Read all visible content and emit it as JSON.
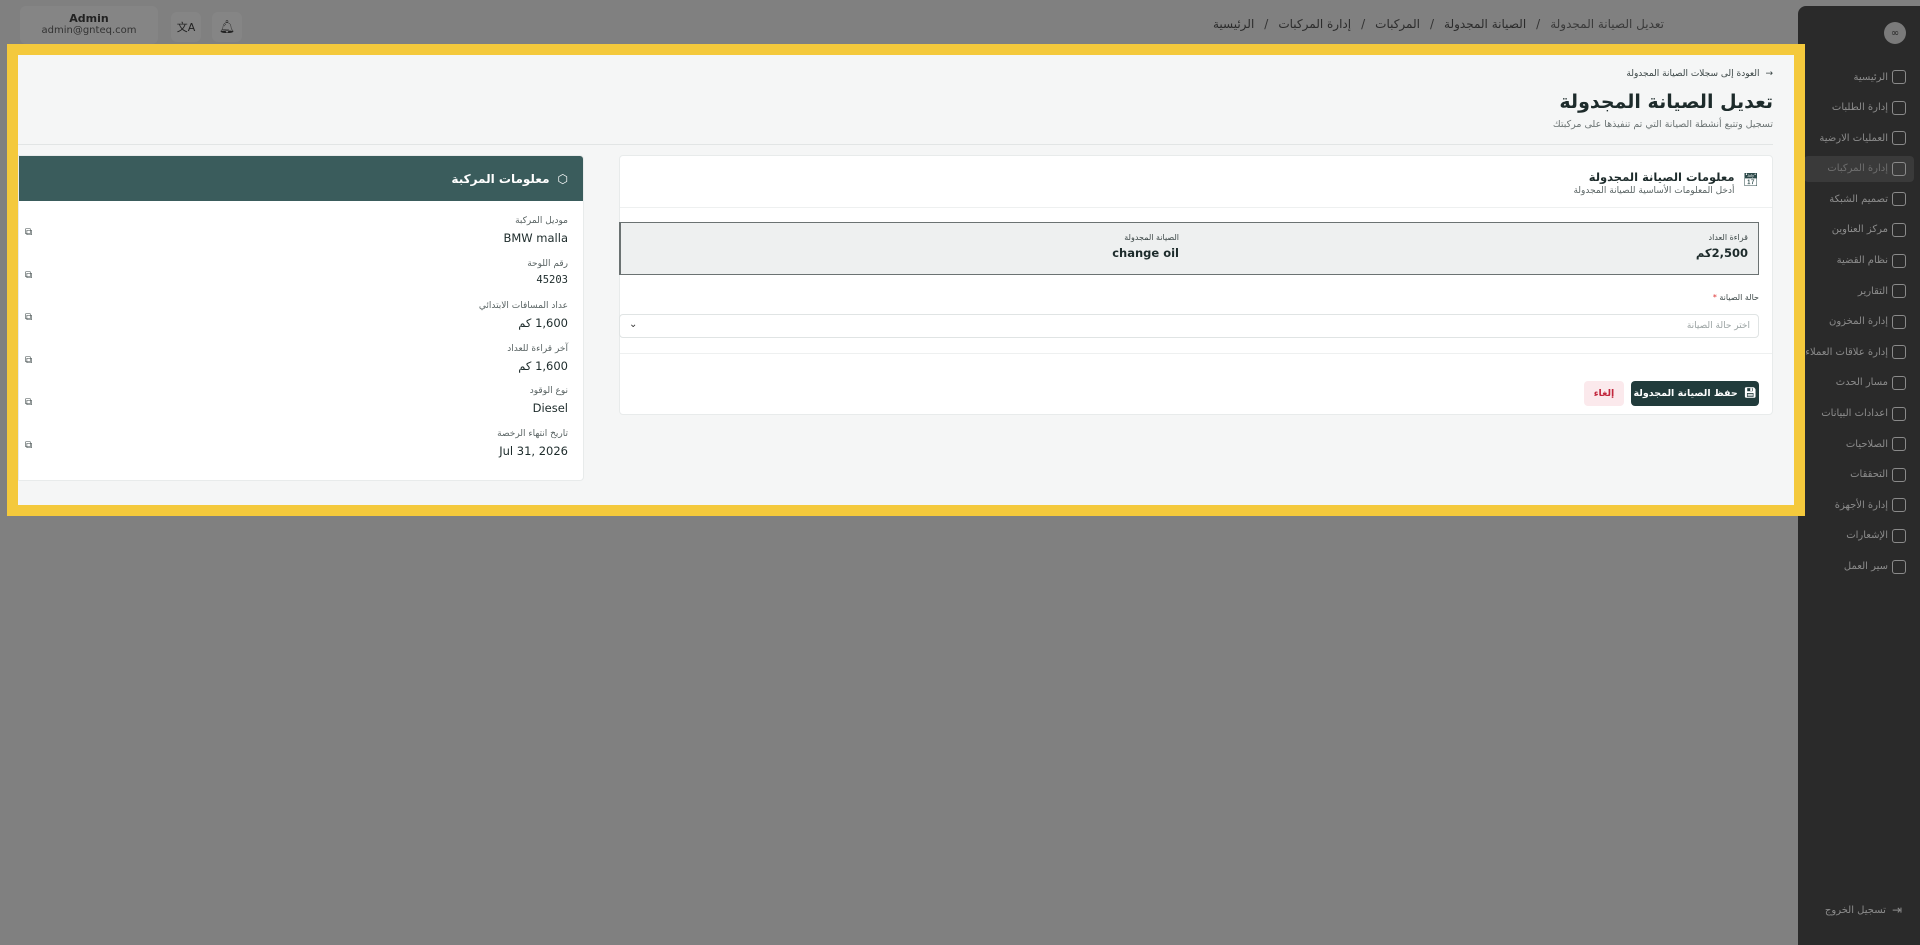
{
  "header": {
    "breadcrumbs": [
      "الرئيسية",
      "إدارة المركبات",
      "المركبات",
      "الصيانة المجدولة",
      "تعديل الصيانة المجدولة"
    ],
    "user_name": "Admin",
    "user_email": "admin@gnteq.com"
  },
  "sidebar": {
    "items": [
      {
        "label": "الرئيسية",
        "icon": "dashboard-icon"
      },
      {
        "label": "إدارة الطلبات",
        "icon": "orders-icon"
      },
      {
        "label": "العمليات الارضية",
        "icon": "ground-ops-icon"
      },
      {
        "label": "إدارة المركبات",
        "icon": "truck-icon",
        "active": true
      },
      {
        "label": "تصميم الشبكة",
        "icon": "network-icon"
      },
      {
        "label": "مركز العناوين",
        "icon": "address-icon"
      },
      {
        "label": "نظام القضية",
        "icon": "case-icon"
      },
      {
        "label": "التقارير",
        "icon": "reports-icon"
      },
      {
        "label": "إدارة المخزون",
        "icon": "inventory-icon"
      },
      {
        "label": "إدارة علاقات العملاء",
        "icon": "crm-icon"
      },
      {
        "label": "مسار الحدث",
        "icon": "event-path-icon"
      },
      {
        "label": "اعدادات البيانات",
        "icon": "database-icon"
      },
      {
        "label": "الصلاحيات",
        "icon": "users-icon"
      },
      {
        "label": "التحققات",
        "icon": "tools-icon"
      },
      {
        "label": "إدارة الأجهزة",
        "icon": "devices-icon"
      },
      {
        "label": "الإشعارات",
        "icon": "bell-icon"
      },
      {
        "label": "سير العمل",
        "icon": "workflow-icon"
      }
    ],
    "logout": "تسجيل الخروج"
  },
  "page": {
    "back_link": "العودة إلى سجلات الصيانة المجدولة",
    "title": "تعديل الصيانة المجدولة",
    "subtitle": "تسجيل وتتبع أنشطة الصيانة التي تم تنفيذها على مركبتك"
  },
  "form": {
    "title": "معلومات الصيانة المجدولة",
    "subtitle": "أدخل المعلومات الأساسية للصيانة المجدولة",
    "odometer_label": "قراءة العداد",
    "odometer_value": "2,500كم",
    "scheduled_label": "الصيانة المجدولة",
    "scheduled_value": "change oil",
    "status_label": "حالة الصيانة",
    "status_required": "*",
    "status_placeholder": "اختر حالة الصيانة",
    "save_label": "حفظ الصيانة المجدولة",
    "cancel_label": "إلغاء"
  },
  "vehicle": {
    "title": "معلومات المركبة",
    "fields": [
      {
        "label": "موديل المركبة",
        "value": "BMW malla"
      },
      {
        "label": "رقم اللوحة",
        "value": "45203"
      },
      {
        "label": "عداد المسافات الابتدائي",
        "value": "1,600 كم"
      },
      {
        "label": "آخر قراءة للعداد",
        "value": "1,600 كم"
      },
      {
        "label": "نوع الوقود",
        "value": "Diesel"
      },
      {
        "label": "تاريخ انتهاء الرخصة",
        "value": "Jul 31, 2026"
      }
    ]
  },
  "colors": {
    "overlay": "#808080",
    "highlight_border": "#f4c93c",
    "primary": "#213b3b",
    "vehicle_header": "#3a5c5c",
    "cancel_text": "#c2273d"
  }
}
